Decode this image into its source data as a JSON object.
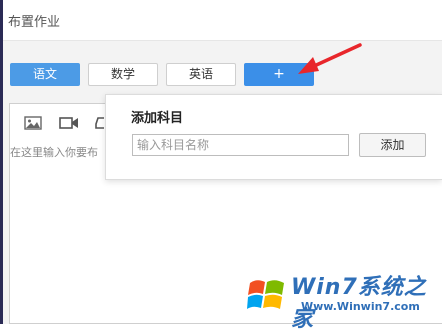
{
  "window": {
    "title": "布置作业"
  },
  "tabs": [
    {
      "label": "语文",
      "active": true
    },
    {
      "label": "数学",
      "active": false
    },
    {
      "label": "英语",
      "active": false
    },
    {
      "label": "+",
      "active": false
    }
  ],
  "editor": {
    "placeholder": "在这里输入你要布",
    "toolbar_icons": [
      "image-icon",
      "video-icon",
      "eraser-icon"
    ]
  },
  "add_subject_popover": {
    "title": "添加科目",
    "input_placeholder": "输入科目名称",
    "input_value": "",
    "button_label": "添加"
  },
  "annotation": {
    "type": "arrow",
    "color": "#e8262b",
    "points_to": "add-subject-button"
  },
  "watermark": {
    "brand": "Win7系统之家",
    "url": "Www.Winwin7.com"
  },
  "colors": {
    "accent": "#4c9be6",
    "add_button": "#3b8fe8",
    "arrow": "#e8262b",
    "watermark": "#2f6fb8"
  }
}
